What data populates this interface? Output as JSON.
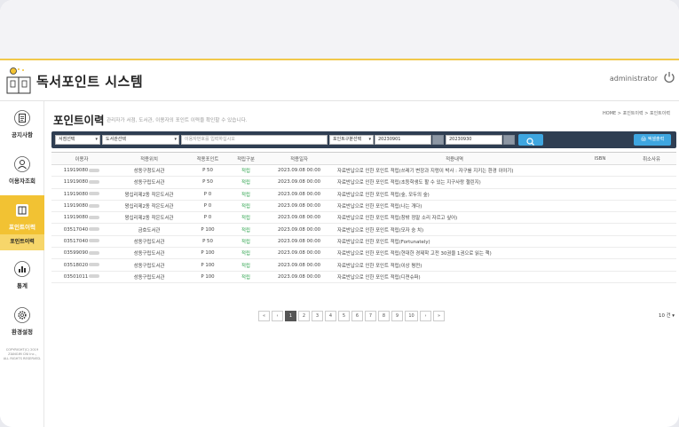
{
  "app": {
    "title": "독서포인트 시스템",
    "user": "administrator"
  },
  "sidebar": {
    "items": [
      {
        "label": "공지사항",
        "icon": "clipboard-icon"
      },
      {
        "label": "이용자조회",
        "icon": "user-search-icon"
      },
      {
        "label": "포인트이력",
        "icon": "book-icon"
      },
      {
        "label": "통계",
        "icon": "chart-icon"
      },
      {
        "label": "환경설정",
        "icon": "gear-icon"
      }
    ],
    "sub_label": "포인트이력",
    "copyright": [
      "COPYRIGHT(C) 2019",
      "ZIANGIM CNI Inc.,",
      "ALL RIGHTS RESERVED."
    ]
  },
  "page": {
    "title": "포인트이력",
    "desc": "관리자가 서점, 도서관, 이용자의 포인트 이력을 확인할 수 있습니다.",
    "breadcrumb": [
      "HOME",
      "포인트이력",
      "포인트이력"
    ]
  },
  "filters": {
    "store_select": "서점선택",
    "library_select": "도서관선택",
    "search_placeholder": "이용자번호를 입력하십시오",
    "type_select": "포인트구분선택",
    "date_from": "20230901",
    "date_to": "20230930",
    "excel_label": "엑셀출력"
  },
  "table": {
    "columns": [
      "이용자",
      "적용위치",
      "적용포인트",
      "적립구분",
      "적용일자",
      "적용내역",
      "ISBN",
      "취소사유"
    ],
    "rows": [
      [
        "11919080",
        "성동구청도서관",
        "P 50",
        "적립",
        "2023.09.08 00:00",
        "자료반납으로 인한 포인트 적립(쓰레기 변장과 지렁이 박사 : 자구를 지키는 환경 이야기)"
      ],
      [
        "11919080",
        "성동구립도서관",
        "P 50",
        "적립",
        "2023.09.08 00:00",
        "자료반납으로 인한 포인트 적립(초등학생도 할 수 있는 지구사랑 챌린지)"
      ],
      [
        "11919080",
        "왕십리제2동 작은도서관",
        "P 0",
        "적립",
        "2023.09.08 00:00",
        "자료반납으로 인한 포인트 적립(숲, 모두의 숲)"
      ],
      [
        "11919080",
        "왕십리제2동 작은도서관",
        "P 0",
        "적립",
        "2023.09.08 00:00",
        "자료반납으로 인한 포인트 적립(나는 개다)"
      ],
      [
        "11919080",
        "왕십리제2동 작은도서관",
        "P 0",
        "적립",
        "2023.09.08 00:00",
        "자료반납으로 인한 포인트 적립(창밖 정말 소리 자르고 싶어)"
      ],
      [
        "03517040",
        "금호도서관",
        "P 100",
        "적립",
        "2023.09.08 00:00",
        "자료반납으로 인한 포인트 적립(모자 숭 치)"
      ],
      [
        "03517040",
        "성동구립도서관",
        "P 50",
        "적립",
        "2023.09.08 00:00",
        "자료반납으로 인한 포인트 적립(Fortunately)"
      ],
      [
        "03599090",
        "성동구립도서관",
        "P 100",
        "적립",
        "2023.09.08 00:00",
        "자료반납으로 인한 포인트 적립(현대한 경제학 고전 30권을 1권으로 읽는 책)"
      ],
      [
        "03518020",
        "성동구립도서관",
        "P 100",
        "적립",
        "2023.09.08 00:00",
        "자료반납으로 인한 포인트 적립(이상 평전)"
      ],
      [
        "03501011",
        "성동구립도서관",
        "P 100",
        "적립",
        "2023.09.08 00:00",
        "자료반납으로 인한 포인트 적립(디젼슈퍼)"
      ]
    ]
  },
  "pagination": {
    "first": "«",
    "prev": "‹",
    "pages": [
      "1",
      "2",
      "3",
      "4",
      "5",
      "6",
      "7",
      "8",
      "9",
      "10"
    ],
    "next": "›",
    "last": "»",
    "active": "1",
    "per_page": "10 건"
  },
  "colors": {
    "accent": "#f2c233",
    "filter_bg": "#2f3e52",
    "button": "#3ea6e0",
    "earn": "#2aa24a"
  }
}
